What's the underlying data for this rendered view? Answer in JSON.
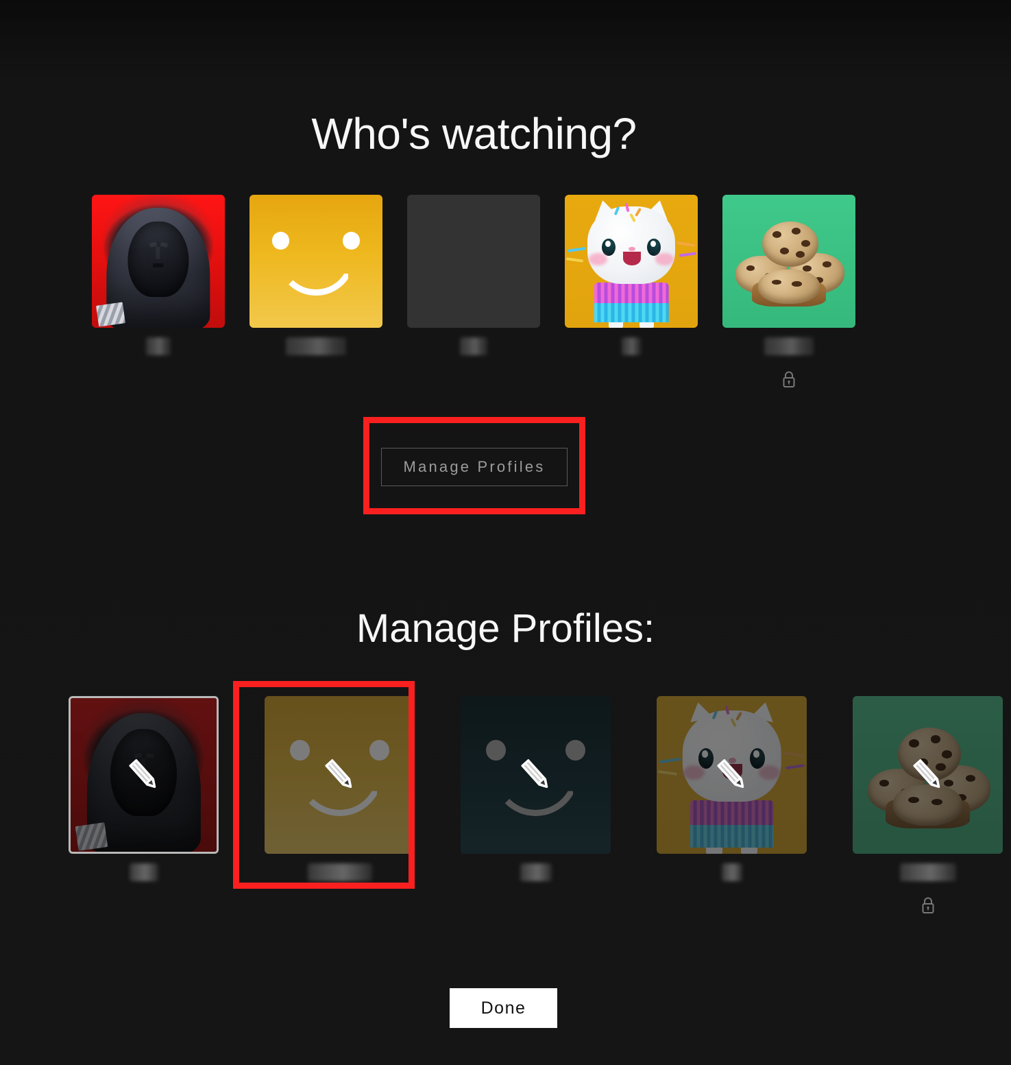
{
  "page": {
    "background_color": "#141414",
    "heading_watching": "Who's watching?",
    "heading_manage": "Manage Profiles:"
  },
  "accent": {
    "annotation_red": "#fa2020",
    "done_button_bg": "#ffffff",
    "manage_button_border": "#5a5a5a"
  },
  "top_row": {
    "profiles": [
      {
        "name_redacted": true,
        "name": "",
        "avatar": "hooded-figure-avatar",
        "avatar_bg": "#e8100f",
        "locked": false
      },
      {
        "name_redacted": true,
        "name": "",
        "avatar": "yellow-smiley-avatar",
        "avatar_bg": "#eeb81f",
        "locked": false
      },
      {
        "name_redacted": true,
        "name": "",
        "avatar": "blank-placeholder-avatar",
        "avatar_bg": "#333333",
        "locked": false
      },
      {
        "name_redacted": true,
        "name": "",
        "avatar": "cupcake-cat-avatar",
        "avatar_bg": "#e8a90f",
        "locked": false
      },
      {
        "name_redacted": true,
        "name": "",
        "avatar": "chocolate-chip-cookies-avatar",
        "avatar_bg": "#3fc98a",
        "locked": true
      }
    ],
    "lock_icon": "lock-icon"
  },
  "manage_button": {
    "label": "Manage Profiles",
    "annotated": true
  },
  "bottom_row": {
    "profiles": [
      {
        "name_redacted": true,
        "name": "",
        "avatar": "hooded-figure-avatar",
        "avatar_bg": "#e8100f",
        "locked": false,
        "focused": true,
        "annotated": false,
        "edit_icon": "pencil-icon"
      },
      {
        "name_redacted": true,
        "name": "",
        "avatar": "yellow-smiley-avatar",
        "avatar_bg": "#eeb81f",
        "locked": false,
        "focused": false,
        "annotated": true,
        "edit_icon": "pencil-icon"
      },
      {
        "name_redacted": true,
        "name": "",
        "avatar": "blank-placeholder-avatar",
        "avatar_bg": "#333333",
        "locked": false,
        "focused": false,
        "annotated": false,
        "edit_icon": "pencil-icon"
      },
      {
        "name_redacted": true,
        "name": "",
        "avatar": "cupcake-cat-avatar",
        "avatar_bg": "#e8a90f",
        "locked": false,
        "focused": false,
        "annotated": false,
        "edit_icon": "pencil-icon"
      },
      {
        "name_redacted": true,
        "name": "",
        "avatar": "chocolate-chip-cookies-avatar",
        "avatar_bg": "#3fc98a",
        "locked": true,
        "focused": false,
        "annotated": false,
        "edit_icon": "pencil-icon"
      }
    ],
    "lock_icon": "lock-icon"
  },
  "done_button": {
    "label": "Done"
  }
}
